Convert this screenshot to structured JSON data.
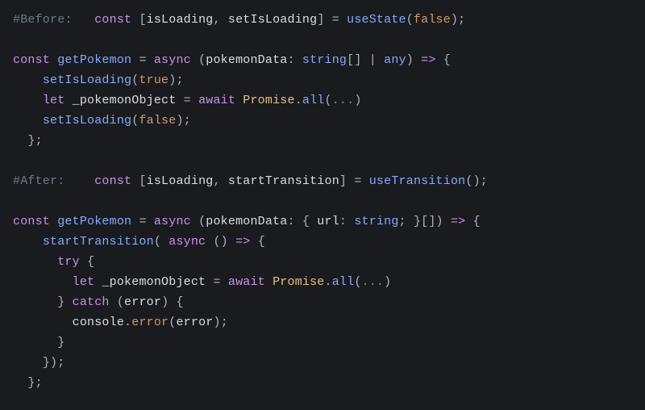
{
  "code": {
    "before_comment": "#Before:",
    "after_comment": "#After:",
    "kw_const": "const",
    "kw_let": "let",
    "kw_async": "async",
    "kw_await": "await",
    "kw_try": "try",
    "kw_catch": "catch",
    "arrow": "=>",
    "isLoading": "isLoading",
    "setIsLoading": "setIsLoading",
    "startTransition": "startTransition",
    "useState": "useState",
    "useTransition": "useTransition",
    "getPokemon": "getPokemon",
    "pokemonData": "pokemonData",
    "string_type": "string",
    "any_type": "any",
    "url_prop": "url",
    "bool_true": "true",
    "bool_false": "false",
    "pokemonObject": "_pokemonObject",
    "Promise": "Promise",
    "all": "all",
    "ellipsis": "...",
    "error_param": "error",
    "console_obj": "console",
    "error_method": "error",
    "eq": "=",
    "comma": ",",
    "colon": ":",
    "semi": ";",
    "dot": ".",
    "pipe": "|",
    "lparen": "(",
    "rparen": ")",
    "lbracket": "[",
    "rbracket": "]",
    "lbrace": "{",
    "rbrace": "}"
  }
}
